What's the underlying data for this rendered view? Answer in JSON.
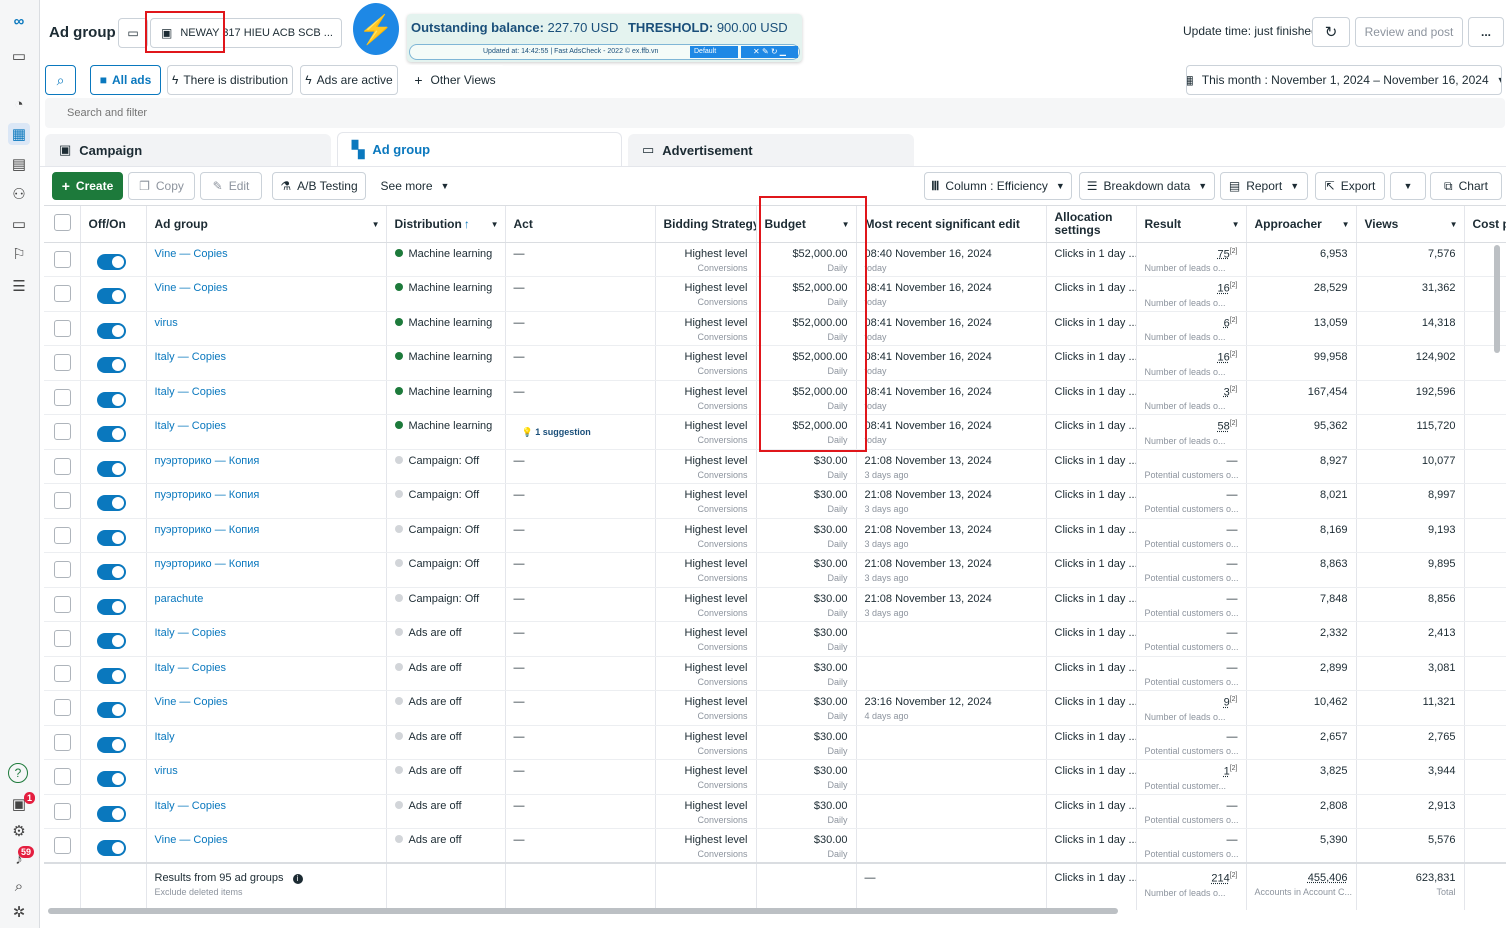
{
  "header": {
    "title": "Ad group",
    "account": "NEWAY 317 HIEU ACB SCB ...",
    "update_time": "Update time: just finished",
    "review_btn": "Review and post",
    "more_btn": "..."
  },
  "extension": {
    "balance_label": "Outstanding balance:",
    "balance_value": "227.70 USD",
    "threshold_label": "THRESHOLD:",
    "threshold_value": "900.00 USD",
    "updated": "Updated at: 14:42:55 | Fast AdsCheck - 2022 © ex.ffb.vn",
    "profile": "Default"
  },
  "filters": {
    "all_ads": "All ads",
    "distribution": "There is distribution",
    "active": "Ads are active",
    "other": "Other Views",
    "date_range": "This month : November 1, 2024 – November 16, 2024",
    "search_placeholder": "Search and filter"
  },
  "tabs": {
    "campaign": "Campaign",
    "adgroup": "Ad group",
    "advertisement": "Advertisement"
  },
  "toolbar": {
    "create": "Create",
    "copy": "Copy",
    "edit": "Edit",
    "ab": "A/B Testing",
    "see_more": "See more",
    "column": "Column : Efficiency",
    "breakdown": "Breakdown data",
    "report": "Report",
    "export": "Export",
    "chart": "Chart"
  },
  "columns": {
    "toggle": "Off/On",
    "name": "Ad group",
    "distribution": "Distribution",
    "act": "Act",
    "bidding": "Bidding Strategy",
    "budget": "Budget",
    "edit": "Most recent significant edit",
    "allocation": "Allocation settings",
    "result": "Result",
    "approacher": "Approacher",
    "views": "Views",
    "cost": "Cost p"
  },
  "rows": [
    {
      "name": "Vine — Copies",
      "dist": "Machine learning",
      "dist_on": true,
      "act": "—",
      "bid": "Highest level",
      "bid_sub": "Conversions",
      "budget": "$52,000.00",
      "budget_sub": "Daily",
      "edit": "08:40 November 16, 2024",
      "edit_sub": "today",
      "alloc": "Clicks in 1 day ...",
      "result": "75",
      "result_sub": "Number of leads o...",
      "approacher": "6,953",
      "views": "7,576"
    },
    {
      "name": "Vine — Copies",
      "dist": "Machine learning",
      "dist_on": true,
      "act": "—",
      "bid": "Highest level",
      "bid_sub": "Conversions",
      "budget": "$52,000.00",
      "budget_sub": "Daily",
      "edit": "08:41 November 16, 2024",
      "edit_sub": "today",
      "alloc": "Clicks in 1 day ...",
      "result": "16",
      "result_sub": "Number of leads o...",
      "approacher": "28,529",
      "views": "31,362"
    },
    {
      "name": "virus",
      "dist": "Machine learning",
      "dist_on": true,
      "act": "—",
      "bid": "Highest level",
      "bid_sub": "Conversions",
      "budget": "$52,000.00",
      "budget_sub": "Daily",
      "edit": "08:41 November 16, 2024",
      "edit_sub": "today",
      "alloc": "Clicks in 1 day ...",
      "result": "6",
      "result_sub": "Number of leads o...",
      "approacher": "13,059",
      "views": "14,318"
    },
    {
      "name": "Italy — Copies",
      "dist": "Machine learning",
      "dist_on": true,
      "act": "—",
      "bid": "Highest level",
      "bid_sub": "Conversions",
      "budget": "$52,000.00",
      "budget_sub": "Daily",
      "edit": "08:41 November 16, 2024",
      "edit_sub": "today",
      "alloc": "Clicks in 1 day ...",
      "result": "16",
      "result_sub": "Number of leads o...",
      "approacher": "99,958",
      "views": "124,902"
    },
    {
      "name": "Italy — Copies",
      "dist": "Machine learning",
      "dist_on": true,
      "act": "—",
      "bid": "Highest level",
      "bid_sub": "Conversions",
      "budget": "$52,000.00",
      "budget_sub": "Daily",
      "edit": "08:41 November 16, 2024",
      "edit_sub": "today",
      "alloc": "Clicks in 1 day ...",
      "result": "3",
      "result_sub": "Number of leads o...",
      "approacher": "167,454",
      "views": "192,596"
    },
    {
      "name": "Italy — Copies",
      "dist": "Machine learning",
      "dist_on": true,
      "act": "1 suggestion",
      "bid": "Highest level",
      "bid_sub": "Conversions",
      "budget": "$52,000.00",
      "budget_sub": "Daily",
      "edit": "08:41 November 16, 2024",
      "edit_sub": "today",
      "alloc": "Clicks in 1 day ...",
      "result": "58",
      "result_sub": "Number of leads o...",
      "approacher": "95,362",
      "views": "115,720"
    },
    {
      "name": "пуэрторико — Копия",
      "dist": "Campaign: Off",
      "dist_on": false,
      "act": "—",
      "bid": "Highest level",
      "bid_sub": "Conversions",
      "budget": "$30.00",
      "budget_sub": "Daily",
      "edit": "21:08 November 13, 2024",
      "edit_sub": "3 days ago",
      "alloc": "Clicks in 1 day ...",
      "result": "—",
      "result_sub": "Potential customers o...",
      "approacher": "8,927",
      "views": "10,077"
    },
    {
      "name": "пуэрторико — Копия",
      "dist": "Campaign: Off",
      "dist_on": false,
      "act": "—",
      "bid": "Highest level",
      "bid_sub": "Conversions",
      "budget": "$30.00",
      "budget_sub": "Daily",
      "edit": "21:08 November 13, 2024",
      "edit_sub": "3 days ago",
      "alloc": "Clicks in 1 day ...",
      "result": "—",
      "result_sub": "Potential customers o...",
      "approacher": "8,021",
      "views": "8,997"
    },
    {
      "name": "пуэрторико — Копия",
      "dist": "Campaign: Off",
      "dist_on": false,
      "act": "—",
      "bid": "Highest level",
      "bid_sub": "Conversions",
      "budget": "$30.00",
      "budget_sub": "Daily",
      "edit": "21:08 November 13, 2024",
      "edit_sub": "3 days ago",
      "alloc": "Clicks in 1 day ...",
      "result": "—",
      "result_sub": "Potential customers o...",
      "approacher": "8,169",
      "views": "9,193"
    },
    {
      "name": "пуэрторико — Копия",
      "dist": "Campaign: Off",
      "dist_on": false,
      "act": "—",
      "bid": "Highest level",
      "bid_sub": "Conversions",
      "budget": "$30.00",
      "budget_sub": "Daily",
      "edit": "21:08 November 13, 2024",
      "edit_sub": "3 days ago",
      "alloc": "Clicks in 1 day ...",
      "result": "—",
      "result_sub": "Potential customers o...",
      "approacher": "8,863",
      "views": "9,895"
    },
    {
      "name": "parachute",
      "dist": "Campaign: Off",
      "dist_on": false,
      "act": "—",
      "bid": "Highest level",
      "bid_sub": "Conversions",
      "budget": "$30.00",
      "budget_sub": "Daily",
      "edit": "21:08 November 13, 2024",
      "edit_sub": "3 days ago",
      "alloc": "Clicks in 1 day ...",
      "result": "—",
      "result_sub": "Potential customers o...",
      "approacher": "7,848",
      "views": "8,856"
    },
    {
      "name": "Italy — Copies",
      "dist": "Ads are off",
      "dist_on": false,
      "act": "—",
      "bid": "Highest level",
      "bid_sub": "Conversions",
      "budget": "$30.00",
      "budget_sub": "Daily",
      "edit": "",
      "edit_sub": "",
      "alloc": "Clicks in 1 day ...",
      "result": "—",
      "result_sub": "Potential customers o...",
      "approacher": "2,332",
      "views": "2,413"
    },
    {
      "name": "Italy — Copies",
      "dist": "Ads are off",
      "dist_on": false,
      "act": "—",
      "bid": "Highest level",
      "bid_sub": "Conversions",
      "budget": "$30.00",
      "budget_sub": "Daily",
      "edit": "",
      "edit_sub": "",
      "alloc": "Clicks in 1 day ...",
      "result": "—",
      "result_sub": "Potential customers o...",
      "approacher": "2,899",
      "views": "3,081"
    },
    {
      "name": "Vine — Copies",
      "dist": "Ads are off",
      "dist_on": false,
      "act": "—",
      "bid": "Highest level",
      "bid_sub": "Conversions",
      "budget": "$30.00",
      "budget_sub": "Daily",
      "edit": "23:16 November 12, 2024",
      "edit_sub": "4 days ago",
      "alloc": "Clicks in 1 day ...",
      "result": "9",
      "result_sub": "Number of leads o...",
      "approacher": "10,462",
      "views": "11,321"
    },
    {
      "name": "Italy",
      "dist": "Ads are off",
      "dist_on": false,
      "act": "—",
      "bid": "Highest level",
      "bid_sub": "Conversions",
      "budget": "$30.00",
      "budget_sub": "Daily",
      "edit": "",
      "edit_sub": "",
      "alloc": "Clicks in 1 day ...",
      "result": "—",
      "result_sub": "Potential customers o...",
      "approacher": "2,657",
      "views": "2,765"
    },
    {
      "name": "virus",
      "dist": "Ads are off",
      "dist_on": false,
      "act": "—",
      "bid": "Highest level",
      "bid_sub": "Conversions",
      "budget": "$30.00",
      "budget_sub": "Daily",
      "edit": "",
      "edit_sub": "",
      "alloc": "Clicks in 1 day ...",
      "result": "1",
      "result_sub": "Potential customer...",
      "approacher": "3,825",
      "views": "3,944"
    },
    {
      "name": "Italy — Copies",
      "dist": "Ads are off",
      "dist_on": false,
      "act": "—",
      "bid": "Highest level",
      "bid_sub": "Conversions",
      "budget": "$30.00",
      "budget_sub": "Daily",
      "edit": "",
      "edit_sub": "",
      "alloc": "Clicks in 1 day ...",
      "result": "—",
      "result_sub": "Potential customers o...",
      "approacher": "2,808",
      "views": "2,913"
    },
    {
      "name": "Vine — Copies",
      "dist": "Ads are off",
      "dist_on": false,
      "act": "—",
      "bid": "Highest level",
      "bid_sub": "Conversions",
      "budget": "$30.00",
      "budget_sub": "Daily",
      "edit": "",
      "edit_sub": "",
      "alloc": "Clicks in 1 day ...",
      "result": "—",
      "result_sub": "Potential customers o...",
      "approacher": "5,390",
      "views": "5,576"
    }
  ],
  "footer": {
    "label": "Results from 95 ad groups",
    "sub": "Exclude deleted items",
    "edit": "—",
    "alloc": "Clicks in 1 day ...",
    "result": "214",
    "result_sub": "Number of leads o...",
    "approacher": "455,406",
    "approacher_sub": "Accounts in Account C...",
    "views": "623,831",
    "views_sub": "Total"
  },
  "rail": {
    "notif_badge": "1",
    "bell_badge": "59"
  }
}
